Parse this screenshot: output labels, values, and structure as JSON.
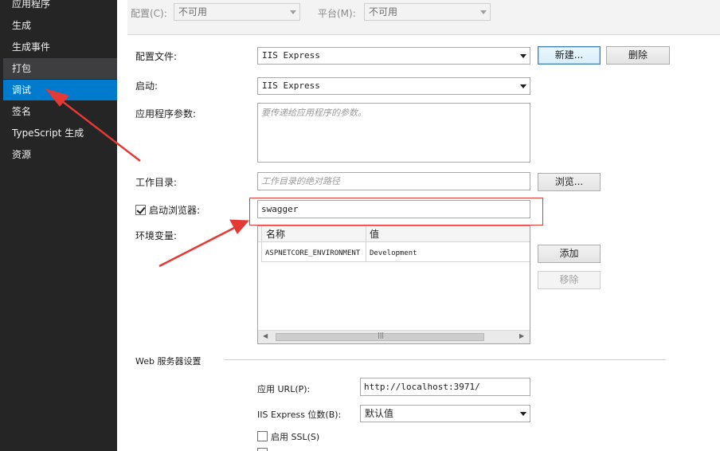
{
  "sidebar": {
    "items": [
      {
        "label": "应用程序"
      },
      {
        "label": "生成"
      },
      {
        "label": "生成事件"
      },
      {
        "label": "打包"
      },
      {
        "label": "调试"
      },
      {
        "label": "签名"
      },
      {
        "label": "TypeScript 生成"
      },
      {
        "label": "资源"
      }
    ],
    "active": "调试"
  },
  "topbar": {
    "config_label": "配置(C):",
    "config_value": "不可用",
    "platform_label": "平台(M):",
    "platform_value": "不可用"
  },
  "profile": {
    "label": "配置文件:",
    "value": "IIS Express",
    "new_button": "新建...",
    "delete_button": "删除"
  },
  "launch": {
    "label": "启动:",
    "value": "IIS Express"
  },
  "app_args": {
    "label": "应用程序参数:",
    "placeholder": "要传递给应用程序的参数。"
  },
  "working_dir": {
    "label": "工作目录:",
    "placeholder": "工作目录的绝对路径",
    "browse_button": "浏览..."
  },
  "launch_browser": {
    "label": "启动浏览器:",
    "checked": true,
    "value": "swagger"
  },
  "env": {
    "label": "环境变量:",
    "columns": [
      "名称",
      "值"
    ],
    "rows": [
      {
        "name": "ASPNETCORE_ENVIRONMENT",
        "value": "Development"
      }
    ],
    "add_button": "添加",
    "remove_button": "移除"
  },
  "web_server": {
    "section_title": "Web 服务器设置",
    "app_url_label": "应用 URL(P):",
    "app_url_value": "http://localhost:3971/",
    "bitness_label": "IIS Express 位数(B):",
    "bitness_value": "默认值",
    "ssl_label": "启用 SSL(S)",
    "ssl_checked": false
  },
  "annotation_color": "#e53935",
  "accent_color": "#007acc"
}
